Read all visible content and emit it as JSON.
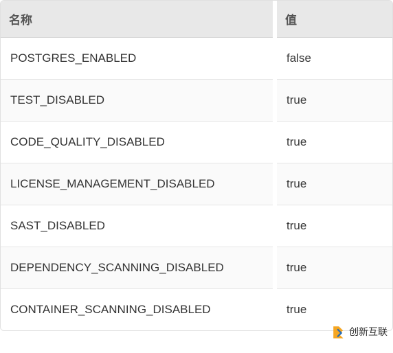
{
  "table": {
    "headers": {
      "name": "名称",
      "value": "值"
    },
    "rows": [
      {
        "name": "POSTGRES_ENABLED",
        "value": "false"
      },
      {
        "name": "TEST_DISABLED",
        "value": "true"
      },
      {
        "name": "CODE_QUALITY_DISABLED",
        "value": "true"
      },
      {
        "name": "LICENSE_MANAGEMENT_DISABLED",
        "value": "true"
      },
      {
        "name": "SAST_DISABLED",
        "value": "true"
      },
      {
        "name": "DEPENDENCY_SCANNING_DISABLED",
        "value": "true"
      },
      {
        "name": "CONTAINER_SCANNING_DISABLED",
        "value": "true"
      }
    ]
  },
  "watermark": {
    "text": "创新互联"
  }
}
